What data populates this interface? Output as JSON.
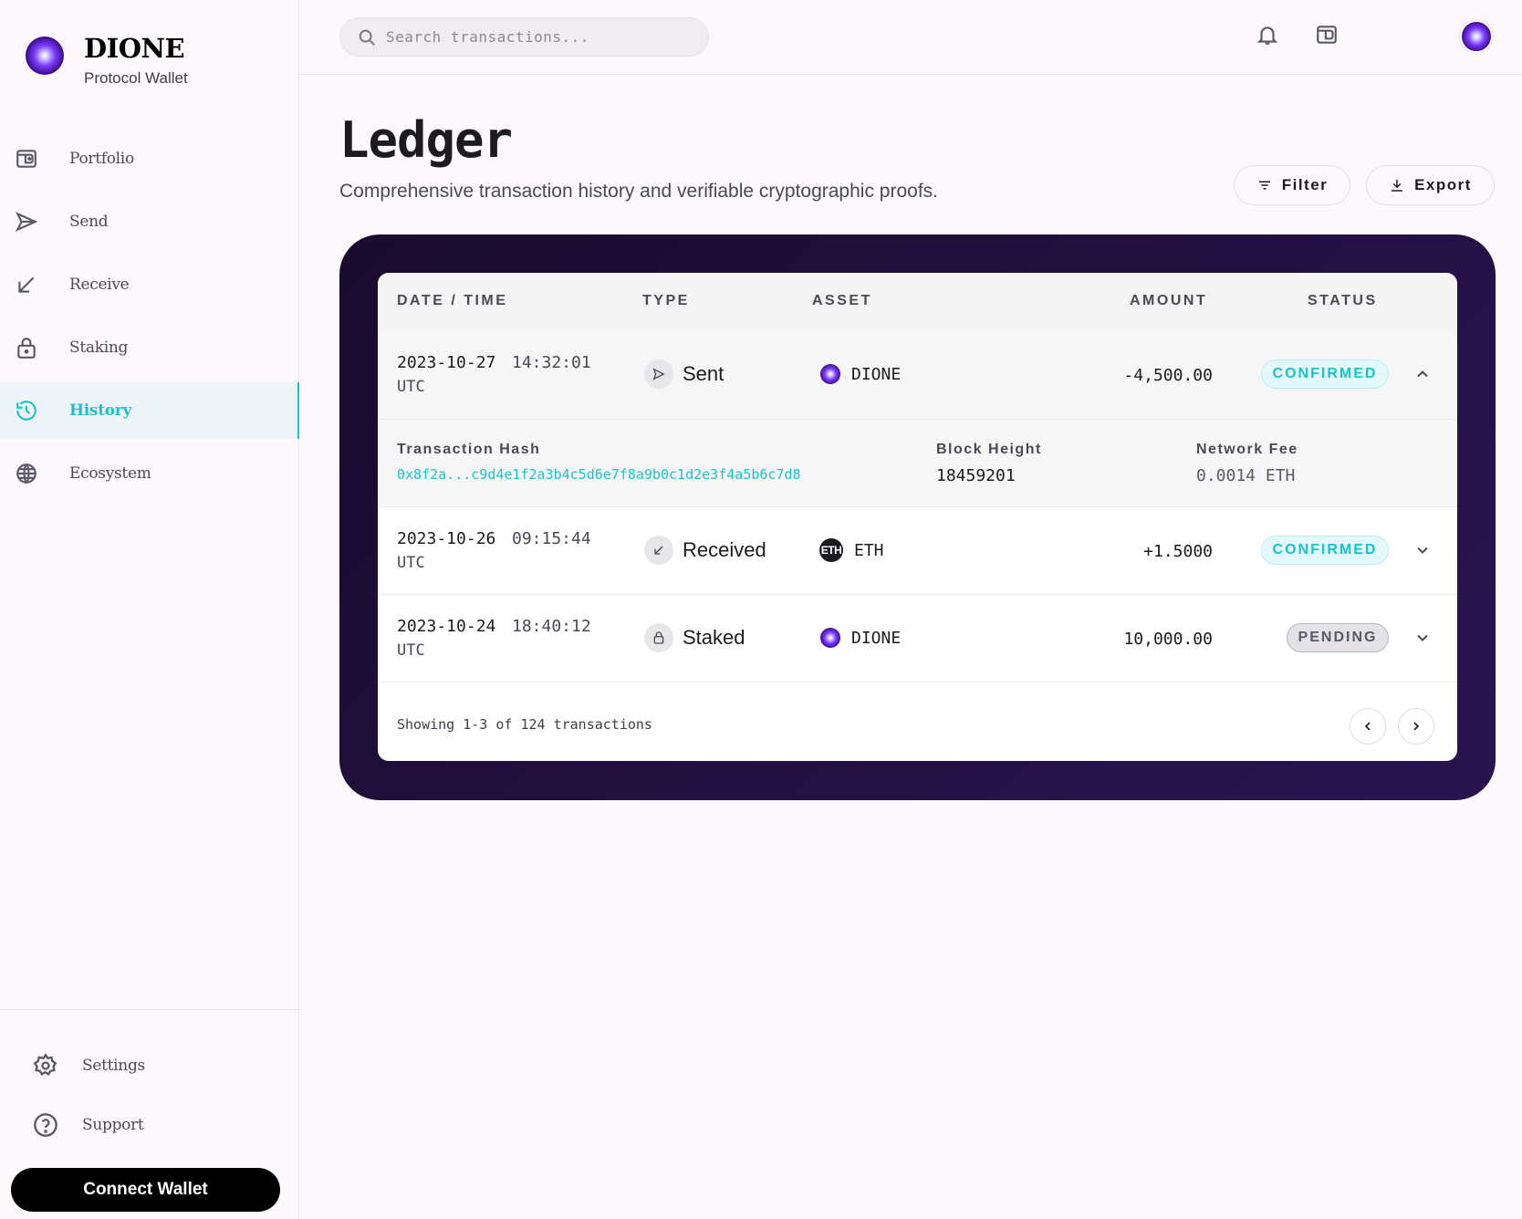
{
  "brand": {
    "name": "DIONE",
    "subtitle": "Protocol Wallet"
  },
  "sidebar": {
    "items": [
      {
        "label": "Portfolio",
        "icon": "wallet-icon",
        "active": false
      },
      {
        "label": "Send",
        "icon": "send-icon",
        "active": false
      },
      {
        "label": "Receive",
        "icon": "receive-icon",
        "active": false
      },
      {
        "label": "Staking",
        "icon": "lock-icon",
        "active": false
      },
      {
        "label": "History",
        "icon": "history-icon",
        "active": true
      },
      {
        "label": "Ecosystem",
        "icon": "globe-icon",
        "active": false
      }
    ],
    "bottom": [
      {
        "label": "Settings",
        "icon": "gear-icon"
      },
      {
        "label": "Support",
        "icon": "help-icon"
      }
    ],
    "connect_label": "Connect Wallet"
  },
  "topbar": {
    "search_placeholder": "Search transactions...",
    "icons": [
      "bell-icon",
      "wallet-icon",
      "avatar"
    ]
  },
  "page": {
    "title": "Ledger",
    "subtitle": "Comprehensive transaction history and verifiable cryptographic proofs.",
    "filter_label": "Filter",
    "export_label": "Export"
  },
  "table": {
    "headers": {
      "date": "DATE / TIME",
      "type": "TYPE",
      "asset": "ASSET",
      "amount": "AMOUNT",
      "status": "STATUS"
    },
    "rows": [
      {
        "date": "2023-10-27",
        "time": "14:32:01",
        "tz": "UTC",
        "type": "Sent",
        "type_icon": "send-icon",
        "asset": "DIONE",
        "asset_icon": "dione-orb",
        "amount": "-4,500.00",
        "status": "CONFIRMED",
        "expanded": true
      },
      {
        "date": "2023-10-26",
        "time": "09:15:44",
        "tz": "UTC",
        "type": "Received",
        "type_icon": "receive-icon",
        "asset": "ETH",
        "asset_icon": "eth-badge",
        "asset_badge_text": "ETH",
        "amount": "+1.5000",
        "status": "CONFIRMED",
        "expanded": false
      },
      {
        "date": "2023-10-24",
        "time": "18:40:12",
        "tz": "UTC",
        "type": "Staked",
        "type_icon": "lock-icon",
        "asset": "DIONE",
        "asset_icon": "dione-orb",
        "amount": "10,000.00",
        "status": "PENDING",
        "expanded": false
      }
    ],
    "detail": {
      "hash_label": "Transaction Hash",
      "hash_value": "0x8f2a...c9d4e1f2a3b4c5d6e7f8a9b0c1d2e3f4a5b6c7d8",
      "block_label": "Block Height",
      "block_value": "18459201",
      "fee_label": "Network Fee",
      "fee_value": "0.0014 ETH"
    },
    "footer": "Showing 1-3 of 124 transactions"
  },
  "colors": {
    "accent": "#17c3d1",
    "card_dark": "#1a0b2e",
    "card_dark_end": "#2a1450",
    "background": "#fcf8fc"
  }
}
